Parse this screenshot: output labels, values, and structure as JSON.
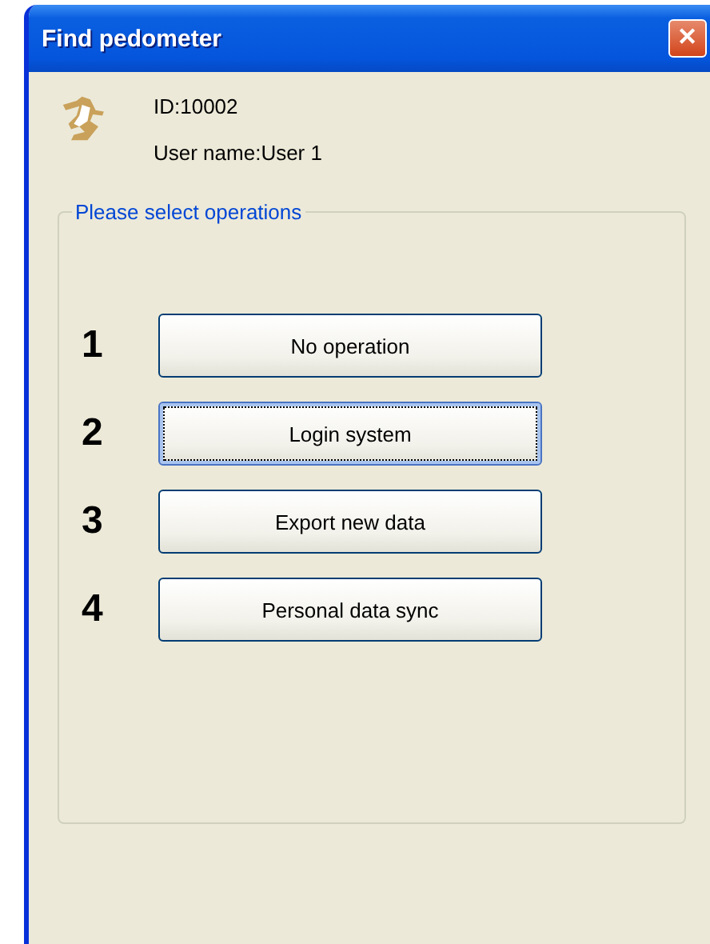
{
  "window": {
    "title": "Find pedometer",
    "close_label": "✕"
  },
  "user": {
    "id": "ID:10002",
    "name": "User name:User 1"
  },
  "operations": {
    "title": "Please select operations",
    "items": [
      {
        "number": "1",
        "label": "No operation",
        "focused": false
      },
      {
        "number": "2",
        "label": "Login system",
        "focused": true
      },
      {
        "number": "3",
        "label": "Export new data",
        "focused": false
      },
      {
        "number": "4",
        "label": "Personal data sync",
        "focused": false
      }
    ]
  }
}
